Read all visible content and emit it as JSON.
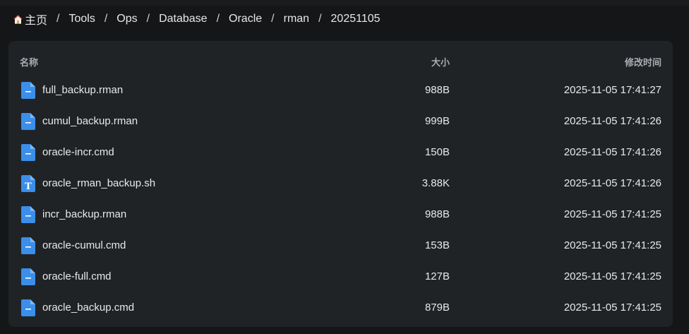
{
  "breadcrumb": {
    "home": "主页",
    "items": [
      "Tools",
      "Ops",
      "Database",
      "Oracle",
      "rman",
      "20251105"
    ],
    "separator": "/"
  },
  "table": {
    "columns": {
      "name": "名称",
      "size": "大小",
      "modified": "修改时间"
    },
    "rows": [
      {
        "name": "full_backup.rman",
        "size": "988B",
        "modified": "2025-11-05 17:41:27",
        "icon": "file-generic-icon"
      },
      {
        "name": "cumul_backup.rman",
        "size": "999B",
        "modified": "2025-11-05 17:41:26",
        "icon": "file-generic-icon"
      },
      {
        "name": "oracle-incr.cmd",
        "size": "150B",
        "modified": "2025-11-05 17:41:26",
        "icon": "file-generic-icon"
      },
      {
        "name": "oracle_rman_backup.sh",
        "size": "3.88K",
        "modified": "2025-11-05 17:41:26",
        "icon": "file-text-icon"
      },
      {
        "name": "incr_backup.rman",
        "size": "988B",
        "modified": "2025-11-05 17:41:25",
        "icon": "file-generic-icon"
      },
      {
        "name": "oracle-cumul.cmd",
        "size": "153B",
        "modified": "2025-11-05 17:41:25",
        "icon": "file-generic-icon"
      },
      {
        "name": "oracle-full.cmd",
        "size": "127B",
        "modified": "2025-11-05 17:41:25",
        "icon": "file-generic-icon"
      },
      {
        "name": "oracle_backup.cmd",
        "size": "879B",
        "modified": "2025-11-05 17:41:25",
        "icon": "file-generic-icon"
      }
    ]
  },
  "colors": {
    "background": "#151617",
    "panel": "#202326",
    "file_icon": "#3b8eea",
    "header_text": "#a9adb2"
  }
}
